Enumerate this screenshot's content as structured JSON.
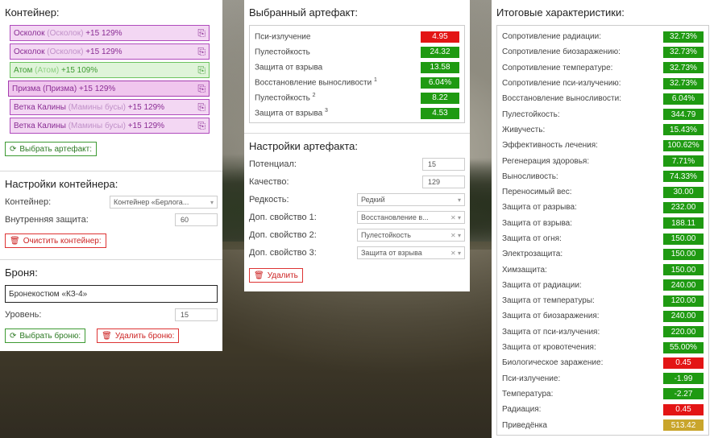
{
  "container": {
    "title": "Контейнер:",
    "items": [
      {
        "name": "Осколок",
        "sub": "(Осколок)",
        "level": "+15 129%",
        "style": "purple"
      },
      {
        "name": "Осколок",
        "sub": "(Осколок)",
        "level": "+15 129%",
        "style": "purple"
      },
      {
        "name": "Атом",
        "sub": "(Атом)",
        "level": "+15 109%",
        "style": "green"
      },
      {
        "name": "Призма",
        "sub": "(Призма)",
        "level": "+15 129%",
        "style": "prism"
      },
      {
        "name": "Ветка Калины",
        "sub": "(Мамины бусы)",
        "level": "+15 129%",
        "style": "purple"
      },
      {
        "name": "Ветка Калины",
        "sub": "(Мамины бусы)",
        "level": "+15 129%",
        "style": "purple"
      }
    ],
    "select_artifact_label": "Выбрать артефакт:"
  },
  "container_settings": {
    "title": "Настройки контейнера:",
    "container_label": "Контейнер:",
    "container_value": "Контейнер «Берлога...",
    "inner_protection_label": "Внутренняя защита:",
    "inner_protection_value": "60",
    "clear_label": "Очистить контейнер:"
  },
  "armor": {
    "title": "Броня:",
    "name_value": "Бронекостюм «КЗ-4»",
    "level_label": "Уровень:",
    "level_value": "15",
    "select_label": "Выбрать броню:",
    "delete_label": "Удалить броню:"
  },
  "selected_artifact": {
    "title": "Выбранный артефакт:",
    "stats": [
      {
        "label": "Пси-излучение",
        "sup": "",
        "value": "4.95",
        "color": "red"
      },
      {
        "label": "Пулестойкость",
        "sup": "",
        "value": "24.32",
        "color": "green"
      },
      {
        "label": "Защита от взрыва",
        "sup": "",
        "value": "13.58",
        "color": "green"
      },
      {
        "label": "Восстановление выносливости",
        "sup": "1",
        "value": "6.04%",
        "color": "green"
      },
      {
        "label": "Пулестойкость",
        "sup": "2",
        "value": "8.22",
        "color": "green"
      },
      {
        "label": "Защита от взрыва",
        "sup": "3",
        "value": "4.53",
        "color": "green"
      }
    ]
  },
  "artifact_settings": {
    "title": "Настройки артефакта:",
    "potential_label": "Потенциал:",
    "potential_value": "15",
    "quality_label": "Качество:",
    "quality_value": "129",
    "rarity_label": "Редкость:",
    "rarity_value": "Редкий",
    "extra1_label": "Доп. свойство 1:",
    "extra1_value": "Восстановление в...",
    "extra2_label": "Доп. свойство 2:",
    "extra2_value": "Пулестойкость",
    "extra3_label": "Доп. свойство 3:",
    "extra3_value": "Защита от взрыва",
    "delete_label": "Удалить"
  },
  "totals": {
    "title": "Итоговые характеристики:",
    "stats": [
      {
        "label": "Сопротивление радиации:",
        "value": "32.73%",
        "color": "green"
      },
      {
        "label": "Сопротивление биозаражению:",
        "value": "32.73%",
        "color": "green"
      },
      {
        "label": "Сопротивление температуре:",
        "value": "32.73%",
        "color": "green"
      },
      {
        "label": "Сопротивление пси-излучению:",
        "value": "32.73%",
        "color": "green"
      },
      {
        "label": "Восстановление выносливости:",
        "value": "6.04%",
        "color": "green"
      },
      {
        "label": "Пулестойкость:",
        "value": "344.79",
        "color": "green"
      },
      {
        "label": "Живучесть:",
        "value": "15.43%",
        "color": "green"
      },
      {
        "label": "Эффективность лечения:",
        "value": "100.62%",
        "color": "green"
      },
      {
        "label": "Регенерация здоровья:",
        "value": "7.71%",
        "color": "green"
      },
      {
        "label": "Выносливость:",
        "value": "74.33%",
        "color": "green"
      },
      {
        "label": "Переносимый вес:",
        "value": "30.00",
        "color": "green"
      },
      {
        "label": "Защита от разрыва:",
        "value": "232.00",
        "color": "green"
      },
      {
        "label": "Защита от взрыва:",
        "value": "188.11",
        "color": "green"
      },
      {
        "label": "Защита от огня:",
        "value": "150.00",
        "color": "green"
      },
      {
        "label": "Электрозащита:",
        "value": "150.00",
        "color": "green"
      },
      {
        "label": "Химзащита:",
        "value": "150.00",
        "color": "green"
      },
      {
        "label": "Защита от радиации:",
        "value": "240.00",
        "color": "green"
      },
      {
        "label": "Защита от температуры:",
        "value": "120.00",
        "color": "green"
      },
      {
        "label": "Защита от биозаражения:",
        "value": "240.00",
        "color": "green"
      },
      {
        "label": "Защита от пси-излучения:",
        "value": "220.00",
        "color": "green"
      },
      {
        "label": "Защита от кровотечения:",
        "value": "55.00%",
        "color": "green"
      },
      {
        "label": "Биологическое заражение:",
        "value": "0.45",
        "color": "red"
      },
      {
        "label": "Пси-излучение:",
        "value": "-1.99",
        "color": "green"
      },
      {
        "label": "Температура:",
        "value": "-2.27",
        "color": "green"
      },
      {
        "label": "Радиация:",
        "value": "0.45",
        "color": "red"
      },
      {
        "label": "Приведёнка",
        "value": "513.42",
        "color": "gold"
      }
    ]
  },
  "icons": {
    "copy": "copy-icon",
    "refresh": "refresh-icon",
    "trash": "trash-icon",
    "chevron": "chevron-down-icon",
    "clear": "clear-x-icon"
  },
  "colors": {
    "green": "#1f9a12",
    "red": "#e31515",
    "gold": "#c9a52b",
    "purple_border": "#b04bbd",
    "green_border": "#6cc35e"
  }
}
